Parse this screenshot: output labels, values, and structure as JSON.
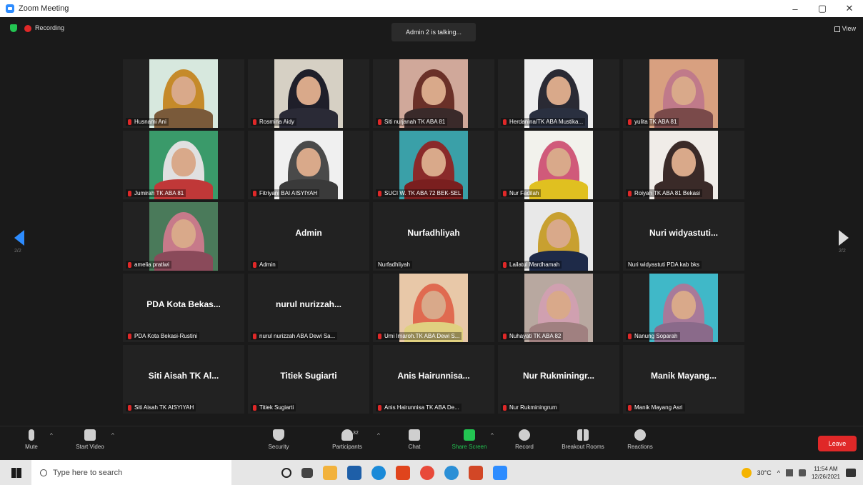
{
  "window": {
    "title": "Zoom Meeting",
    "min": "–",
    "max": "▢",
    "close": "✕"
  },
  "top": {
    "recording": "Recording",
    "talking": "Admin 2 is talking...",
    "view": "View"
  },
  "pager": {
    "left": "2/2",
    "right": "2/2"
  },
  "tiles": [
    {
      "label": "Husnami Ani",
      "video": true,
      "bg": "#d7e8de",
      "hijab": "#c58a2a",
      "body": "#7a5a3a"
    },
    {
      "label": "Rosmina Aidy",
      "video": true,
      "bg": "#d6d0c4",
      "hijab": "#1f1f2a",
      "body": "#2a2a36"
    },
    {
      "label": "Siti nurjanah TK ABA 81",
      "video": true,
      "bg": "#d0a89a",
      "hijab": "#6a3028",
      "body": "#3a2a2a"
    },
    {
      "label": "Herdanina/TK ABA Mustika...",
      "video": true,
      "bg": "#eeeeee",
      "hijab": "#2a2a34",
      "body": "#2a3040"
    },
    {
      "label": "yulita TK ABA 81",
      "video": true,
      "bg": "#d8a080",
      "hijab": "#c07a8a",
      "body": "#7a4a4a"
    },
    {
      "label": "Jumirah TK ABA 81",
      "video": true,
      "bg": "#3a9a6a",
      "hijab": "#e0e0e0",
      "body": "#c03838"
    },
    {
      "label": "Fitriyani BAI AISYIYAH",
      "video": true,
      "bg": "#f0f0f0",
      "hijab": "#4a4a4a",
      "body": "#3a3a3a"
    },
    {
      "label": "SUCI W. TK ABA 72 BEK-SEL",
      "video": true,
      "bg": "#3aa0a8",
      "hijab": "#8a2a2a",
      "body": "#7a1f1f"
    },
    {
      "label": "Nur Fadilah",
      "video": true,
      "bg": "#f2f2ec",
      "hijab": "#d05a7a",
      "body": "#e0c020"
    },
    {
      "label": "Roiyah TK ABA 81 Bekasi",
      "video": true,
      "bg": "#f0ece8",
      "hijab": "#3a2a28",
      "body": "#3a2a28"
    },
    {
      "label": "amelia pratiwi",
      "video": true,
      "bg": "#4a7a5a",
      "hijab": "#c77a8a",
      "body": "#8a4a5a"
    },
    {
      "label": "Admin",
      "video": false,
      "name": "Admin"
    },
    {
      "label": "Nurfadhliyah",
      "video": false,
      "name": "Nurfadhliyah",
      "nomic": true
    },
    {
      "label": "Lailatul Mardhamah",
      "video": true,
      "bg": "#e8e8e8",
      "hijab": "#c8a030",
      "body": "#1e2a48"
    },
    {
      "label": "Nuri widyastuti PDA kab bks",
      "video": false,
      "name": "Nuri widyastuti...",
      "nomic": true
    },
    {
      "label": "PDA Kota Bekasi-Rustini",
      "video": false,
      "name": "PDA Kota Bekas..."
    },
    {
      "label": "nurul nurizzah ABA Dewi Sa...",
      "video": false,
      "name": "nurul nurizzah..."
    },
    {
      "label": "Umi Imaroh.TK ABA Dewi S...",
      "video": true,
      "bg": "#e8c8a8",
      "hijab": "#e06a50",
      "body": "#e0d080"
    },
    {
      "label": "Nuhayati TK ABA 82",
      "video": true,
      "bg": "#b8a8a0",
      "hijab": "#d0a0b0",
      "body": "#a08080"
    },
    {
      "label": "Nanung Soparah",
      "video": true,
      "bg": "#40b8c8",
      "hijab": "#a87a9a",
      "body": "#8a6a8a"
    },
    {
      "label": "Siti Aisah TK AISYIYAH",
      "video": false,
      "name": "Siti Aisah TK Al..."
    },
    {
      "label": "Titiek Sugiarti",
      "video": false,
      "name": "Titiek Sugiarti"
    },
    {
      "label": "Anis Hairunnisa TK ABA De...",
      "video": false,
      "name": "Anis Hairunnisa..."
    },
    {
      "label": "Nur Rukminingrum",
      "video": false,
      "name": "Nur Rukminingr..."
    },
    {
      "label": "Manik Mayang Asri",
      "video": false,
      "name": "Manik Mayang..."
    }
  ],
  "toolbar": {
    "mute": "Mute",
    "start_video": "Start Video",
    "security": "Security",
    "participants": "Participants",
    "participants_count": "32",
    "chat": "Chat",
    "share": "Share Screen",
    "record": "Record",
    "breakout": "Breakout Rooms",
    "reactions": "Reactions",
    "leave": "Leave"
  },
  "taskbar": {
    "search_placeholder": "Type here to search",
    "temperature": "30°C",
    "time": "11:54 AM",
    "date": "12/26/2021"
  }
}
